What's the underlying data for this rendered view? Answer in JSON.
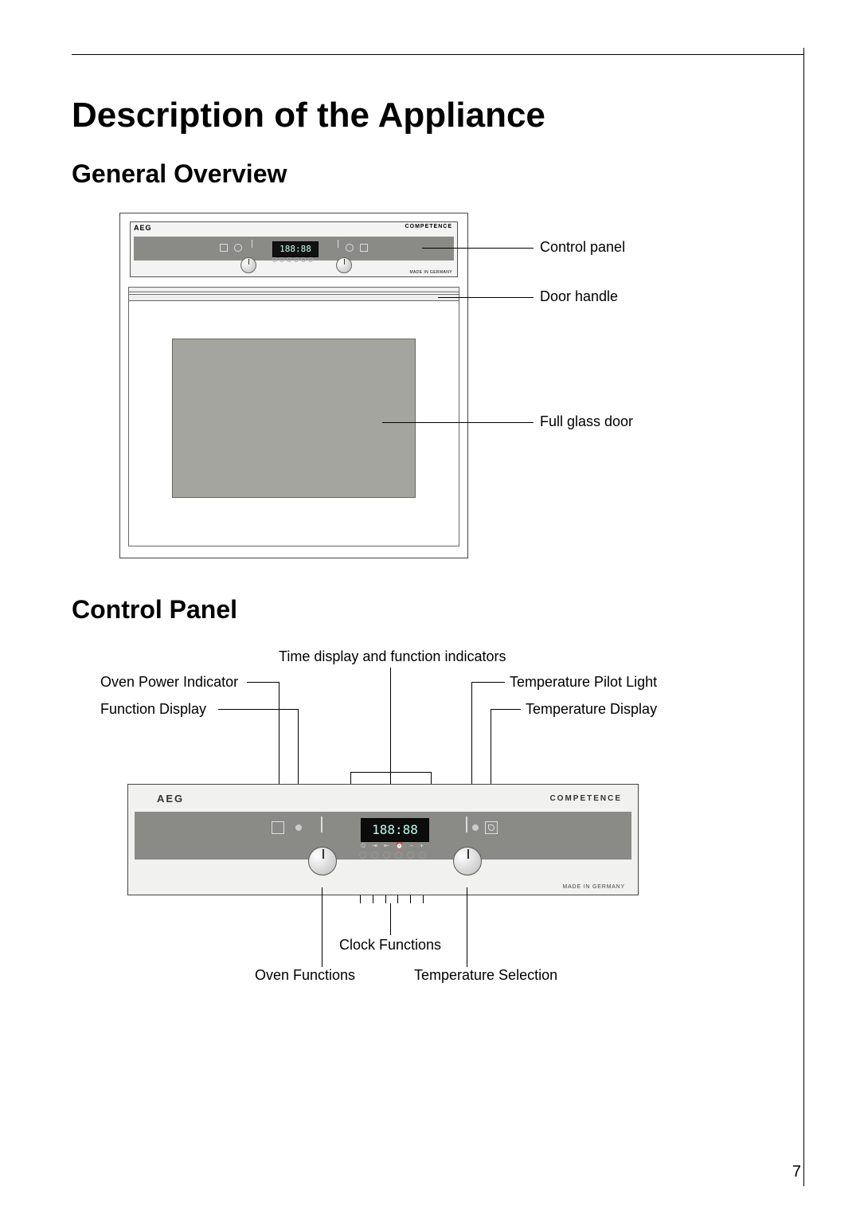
{
  "headings": {
    "title": "Description of the Appliance",
    "section1": "General Overview",
    "section2": "Control Panel"
  },
  "overview": {
    "brand": "AEG",
    "brand_right": "COMPETENCE",
    "lcd": "188:88",
    "made_in": "MADE IN GERMANY",
    "callouts": {
      "control_panel": "Control panel",
      "door_handle": "Door handle",
      "full_glass_door": "Full glass door"
    }
  },
  "controlpanel": {
    "brand": "AEG",
    "brand_right": "COMPETENCE",
    "lcd": "188:88",
    "made_in": "MADE IN GERMANY",
    "labels": {
      "top_center": "Time display and function indicators",
      "left1": "Oven Power Indicator",
      "left2": "Function Display",
      "right1": "Temperature Pilot Light",
      "right2": "Temperature Display",
      "bottom_center": "Clock Functions",
      "bottom_left": "Oven Functions",
      "bottom_right": "Temperature Selection"
    }
  },
  "page_number": "7"
}
